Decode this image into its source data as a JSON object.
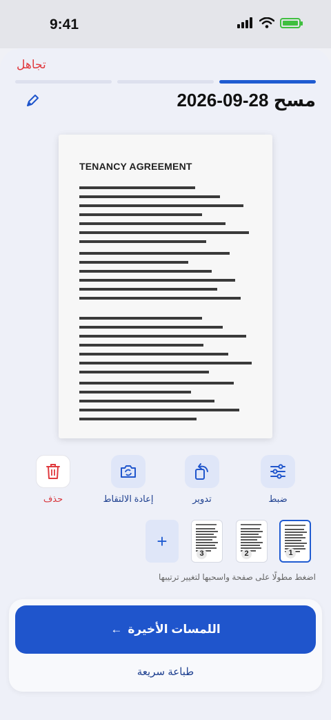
{
  "status": {
    "time": "9:41"
  },
  "header": {
    "ignore": "تجاهل",
    "title": "مسح 28-09-2026",
    "progress_active": 3,
    "progress_total": 3
  },
  "document": {
    "heading": "TENANCY AGREEMENT"
  },
  "tools": [
    {
      "label": "ضبط",
      "icon": "sliders-icon"
    },
    {
      "label": "تدوير",
      "icon": "rotate-icon"
    },
    {
      "label": "إعادة الالتقاط",
      "icon": "camera-retake-icon"
    },
    {
      "label": "حذف",
      "icon": "trash-icon"
    }
  ],
  "pages": [
    {
      "number": "1",
      "selected": true
    },
    {
      "number": "2",
      "selected": false
    },
    {
      "number": "3",
      "selected": false
    }
  ],
  "add_page_label": "+",
  "hint": "اضغط مطولًا على صفحة واسحبها لتغيير ترتيبها",
  "actions": {
    "primary": "اللمسات الأخيرة",
    "primary_arrow": "←",
    "secondary": "طباعة سريعة"
  },
  "colors": {
    "accent": "#1f55cc",
    "danger": "#e0393e",
    "background": "#eef0f8"
  }
}
